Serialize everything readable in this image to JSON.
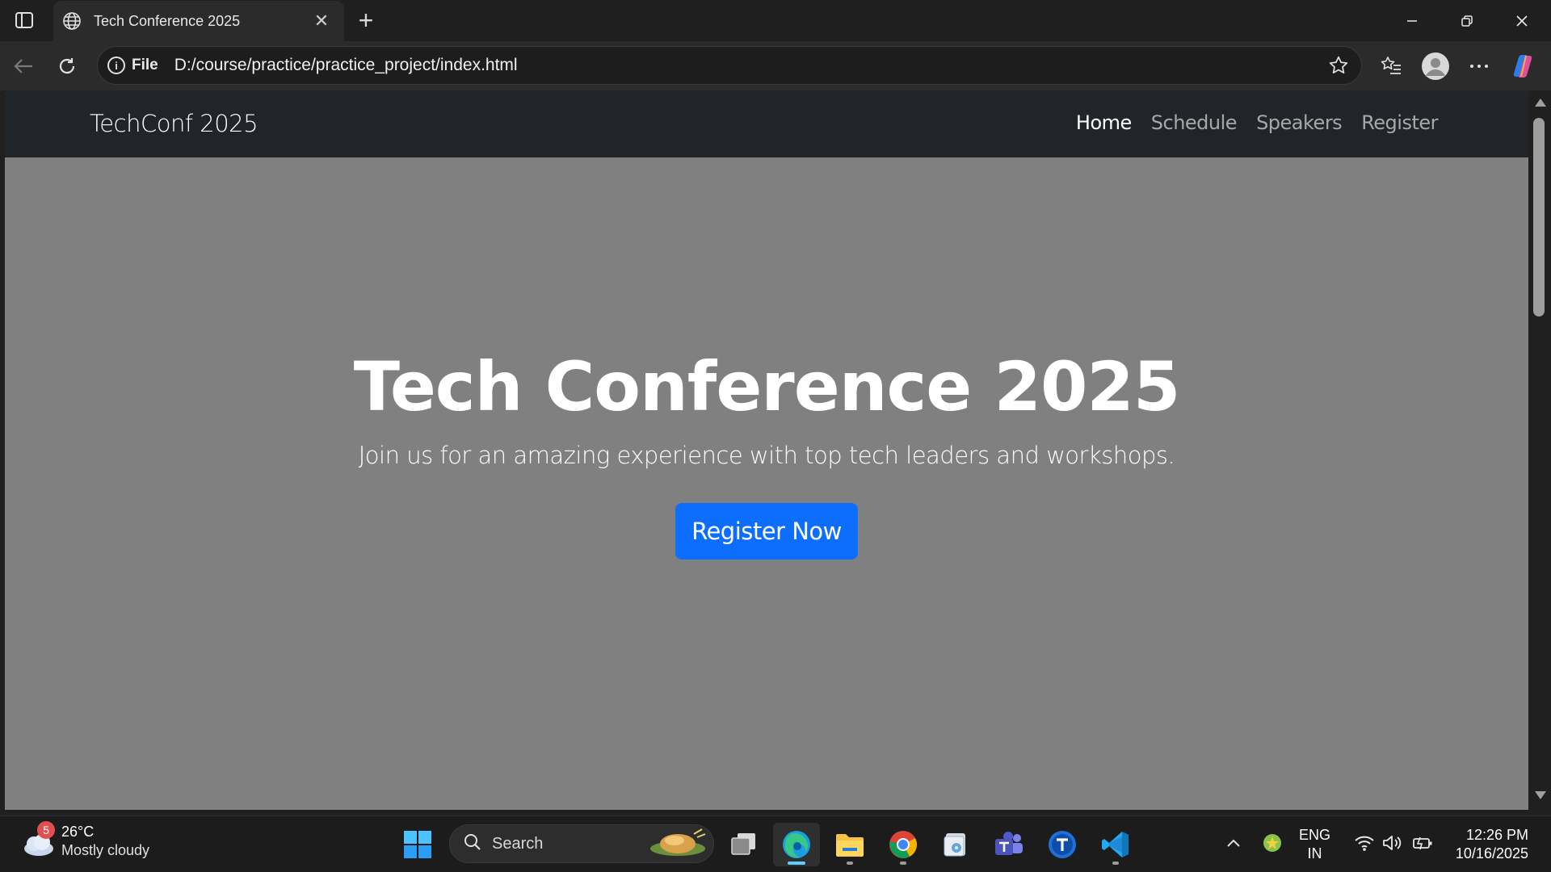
{
  "browser": {
    "tab_title": "Tech Conference 2025",
    "new_tab_symbol": "+",
    "close_tab_symbol": "✕",
    "address_scheme": "File",
    "address_url": "D:/course/practice/practice_project/index.html"
  },
  "page": {
    "brand": "TechConf 2025",
    "nav": [
      {
        "label": "Home",
        "active": true
      },
      {
        "label": "Schedule",
        "active": false
      },
      {
        "label": "Speakers",
        "active": false
      },
      {
        "label": "Register",
        "active": false
      }
    ],
    "hero": {
      "title": "Tech Conference 2025",
      "subtitle": "Join us for an amazing experience with top tech leaders and workshops.",
      "cta": "Register Now"
    },
    "colors": {
      "navbar_bg": "#212529",
      "hero_bg": "#808080",
      "cta_bg": "#0d6efd"
    }
  },
  "taskbar": {
    "weather": {
      "badge": "5",
      "temp": "26°C",
      "condition": "Mostly cloudy"
    },
    "search_label": "Search",
    "lang": {
      "line1": "ENG",
      "line2": "IN"
    },
    "clock": {
      "time": "12:26 PM",
      "date": "10/16/2025"
    },
    "apps": [
      "windows-start-icon",
      "task-view-icon",
      "edge-icon",
      "file-explorer-icon",
      "chrome-icon",
      "media-player-icon",
      "teams-icon",
      "t-app-icon",
      "vscode-icon"
    ]
  }
}
